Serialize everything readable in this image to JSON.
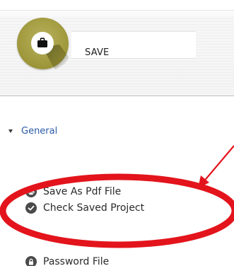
{
  "save_panel": {
    "label": "SAVE",
    "badge_icon": "briefcase-icon",
    "badge_color": "#a39c40"
  },
  "tree": {
    "section_title": "General",
    "section_color": "#2b5aa6",
    "items": [
      {
        "label": "Save As Pdf File",
        "icon": "printer-icon"
      },
      {
        "label": "Check Saved Project",
        "icon": "check-circle-icon"
      },
      {
        "label": "Password File",
        "icon": "lock-icon"
      }
    ]
  },
  "annotation": {
    "color": "#e3141c"
  }
}
